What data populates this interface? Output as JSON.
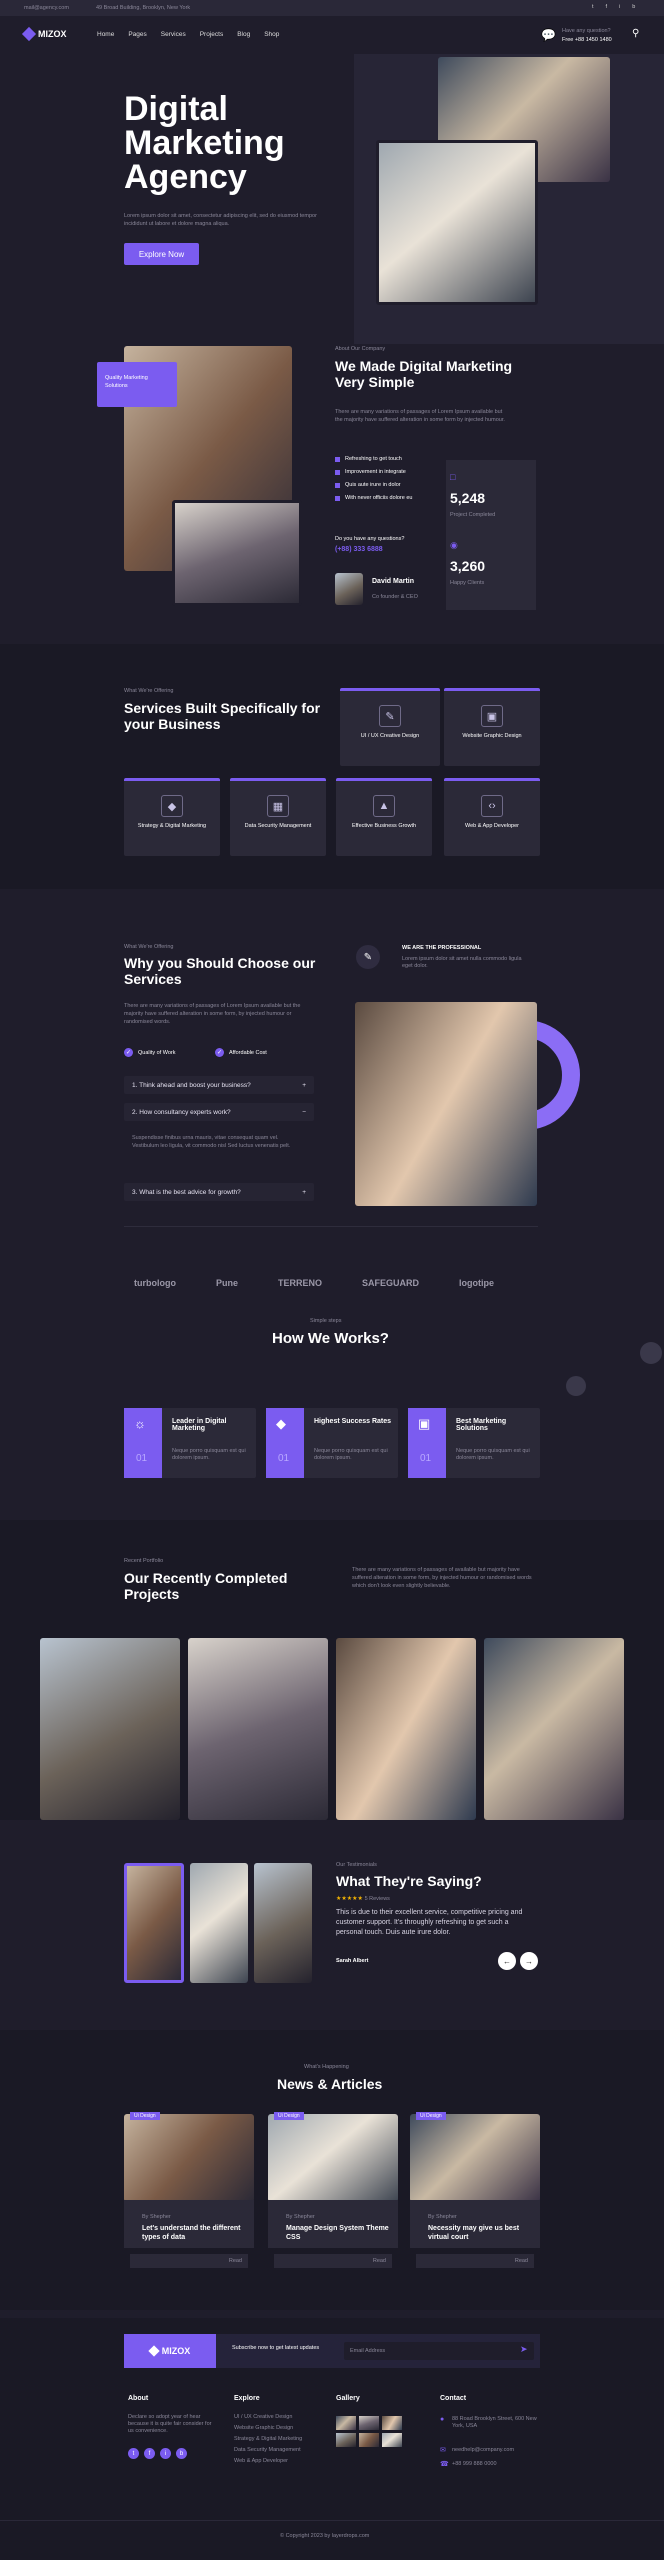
{
  "topbar": {
    "email": "mail@agency.com",
    "address": "49 Broad Building, Brooklyn, New York",
    "socials": [
      "t",
      "f",
      "i",
      "b"
    ]
  },
  "nav": {
    "logo": "MIZOX",
    "items": [
      "Home",
      "Pages",
      "Services",
      "Projects",
      "Blog",
      "Shop"
    ],
    "question": "Have any question?",
    "phone": "Free +88 1450 1480"
  },
  "hero": {
    "title_lines": [
      "Digital",
      "Marketing",
      "Agency"
    ],
    "desc": "Lorem ipsum dolor sit amet, consectetur adipiscing elit, sed do eiusmod tempor incididunt ut labore et dolore magna aliqua.",
    "button": "Explore Now"
  },
  "about": {
    "badge": "Quality Marketing Solutions",
    "kicker": "About Our Company",
    "title": "We Made Digital Marketing Very Simple",
    "desc": "There are many variations of passages of Lorem Ipsum available but the majority have suffered alteration in some form by injected humour.",
    "checks": [
      "Refreshing to get touch",
      "Improvement in integrate",
      "Quis aute irure in dolor",
      "With never officiis dolore eu"
    ],
    "stat1_num": "5,248",
    "stat1_label": "Project Completed",
    "stat2_num": "3,260",
    "stat2_label": "Happy Clients",
    "question": "Do you have any questions?",
    "phone": "(+88) 333 6888",
    "person_name": "David Martin",
    "person_role": "Co founder & CEO"
  },
  "services": {
    "kicker": "What We're Offering",
    "title": "Services Built Specifically for your Business",
    "items": [
      "UI / UX Creative Design",
      "Website Graphic Design",
      "Strategy & Digital Marketing",
      "Data Security Management",
      "Effective Business Growth",
      "Web & App Developer"
    ]
  },
  "why": {
    "kicker": "What We're Offering",
    "title": "Why you Should Choose our Services",
    "desc": "There are many variations of passages of Lorem Ipsum available but the majority have suffered alteration in some form, by injected humour or randomised words.",
    "checks": [
      "Quality of Work",
      "Affordable Cost"
    ],
    "faq": [
      "1. Think ahead and boost your business?",
      "2. How consultancy experts work?",
      "3. What is the best advice for growth?"
    ],
    "faq_answer": "Suspendisse finibus urna mauris, vitae consequat quam vel. Vestibulum leo ligula, vit commodo nisl Sed luctus venenatis pelt.",
    "professional_title": "WE ARE THE PROFESSIONAL",
    "professional_desc": "Lorem ipsum dolor sit amet nulla commodo ligula eget dolor."
  },
  "brands": [
    "turbologo",
    "Pune",
    "TERRENO",
    "SAFEGUARD",
    "logotipe"
  ],
  "works": {
    "kicker": "Simple steps",
    "title": "How We Works?",
    "items": [
      {
        "title": "Leader in Digital Marketing",
        "desc": "Neque porro quisquam est qui dolorem ipsum.",
        "num": "01"
      },
      {
        "title": "Highest Success Rates",
        "desc": "Neque porro quisquam est qui dolorem ipsum.",
        "num": "01"
      },
      {
        "title": "Best Marketing Solutions",
        "desc": "Neque porro quisquam est qui dolorem ipsum.",
        "num": "01"
      }
    ]
  },
  "projects": {
    "kicker": "Recent Portfolio",
    "title": "Our Recently Completed Projects",
    "desc": "There are many variations of passages of available but majority have suffered alteration in some form, by injected humour or randomised words which don't look even slightly believable."
  },
  "testimonial": {
    "kicker": "Our Testimonials",
    "title": "What They're Saying?",
    "rating": "5 Reviews",
    "text": "This is due to their excellent service, competitive pricing and customer support. It's throughly refreshing to get such a personal touch. Duis aute irure dolor.",
    "name": "Sarah Albert"
  },
  "news": {
    "kicker": "What's Happening",
    "title": "News & Articles",
    "posts": [
      {
        "tag": "Ui Design",
        "by": "By Shepher",
        "title": "Let's understand the different types of data",
        "more": "Read"
      },
      {
        "tag": "Ui Design",
        "by": "By Shepher",
        "title": "Manage Design System Theme CSS",
        "more": "Read"
      },
      {
        "tag": "Ui Design",
        "by": "By Shepher",
        "title": "Necessity may give us best virtual court",
        "more": "Read"
      }
    ]
  },
  "newsletter": {
    "logo": "MIZOX",
    "text": "Subscribe now to get latest updates",
    "placeholder": "Email Address"
  },
  "footer": {
    "about_title": "About",
    "about_text": "Declare so adopt year of hear because it is quite fair consider for us convenience.",
    "explore_title": "Explore",
    "explore": [
      "UI / UX Creative Design",
      "Website Graphic Design",
      "Strategy & Digital Marketing",
      "Data Security Management",
      "Web & App Developer"
    ],
    "gallery_title": "Gallery",
    "contact_title": "Contact",
    "address": "88 Road Brooklyn Street, 600 New York, USA",
    "email": "needhelp@company.com",
    "phone": "+88 999 888 0000",
    "copyright": "© Copyright 2023 by layerdrops.com"
  }
}
